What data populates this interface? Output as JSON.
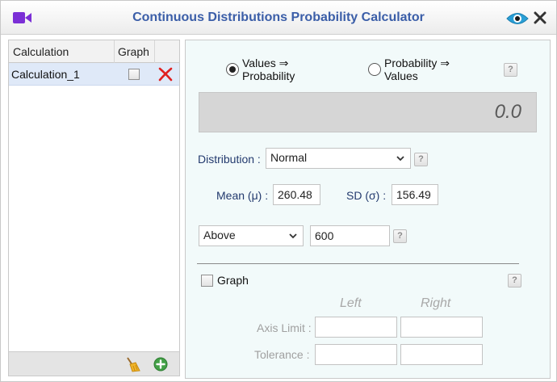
{
  "window": {
    "title": "Continuous Distributions Probability Calculator"
  },
  "calc_table": {
    "headers": {
      "calculation": "Calculation",
      "graph": "Graph"
    },
    "rows": [
      {
        "name": "Calculation_1",
        "graph_checked": false
      }
    ]
  },
  "mode": {
    "option_1_line1": "Values ⇒",
    "option_1_line2": "Probability",
    "option_2_line1": "Probability ⇒",
    "option_2_line2": "Values",
    "selected": "Values ⇒ Probability"
  },
  "help_label": "?",
  "result": {
    "value": "0.0"
  },
  "distribution": {
    "label": "Distribution :",
    "selected": "Normal"
  },
  "params": {
    "mean_label": "Mean (μ) :",
    "mean_value": "260.48",
    "sd_label": "SD (σ) :",
    "sd_value": "156.49"
  },
  "tail": {
    "selected": "Above",
    "value": "600"
  },
  "graph_section": {
    "checkbox_label": "Graph",
    "checked": false,
    "left_header": "Left",
    "right_header": "Right",
    "axis_limit_label": "Axis Limit :",
    "tolerance_label": "Tolerance :",
    "axis_limit_left": "",
    "axis_limit_right": "",
    "tolerance_left": "",
    "tolerance_right": ""
  },
  "colors": {
    "title": "#3b5ea8",
    "accent_icon": "#7b2fd6",
    "panel_bg": "#f2fafa",
    "selected_row": "#dfe9f8",
    "delete": "#e02020",
    "add": "#43a047"
  },
  "icons": [
    "video-icon",
    "eye-icon",
    "close-icon",
    "delete-icon",
    "broom-icon",
    "add-icon",
    "chevron-down-icon",
    "help-icon"
  ]
}
